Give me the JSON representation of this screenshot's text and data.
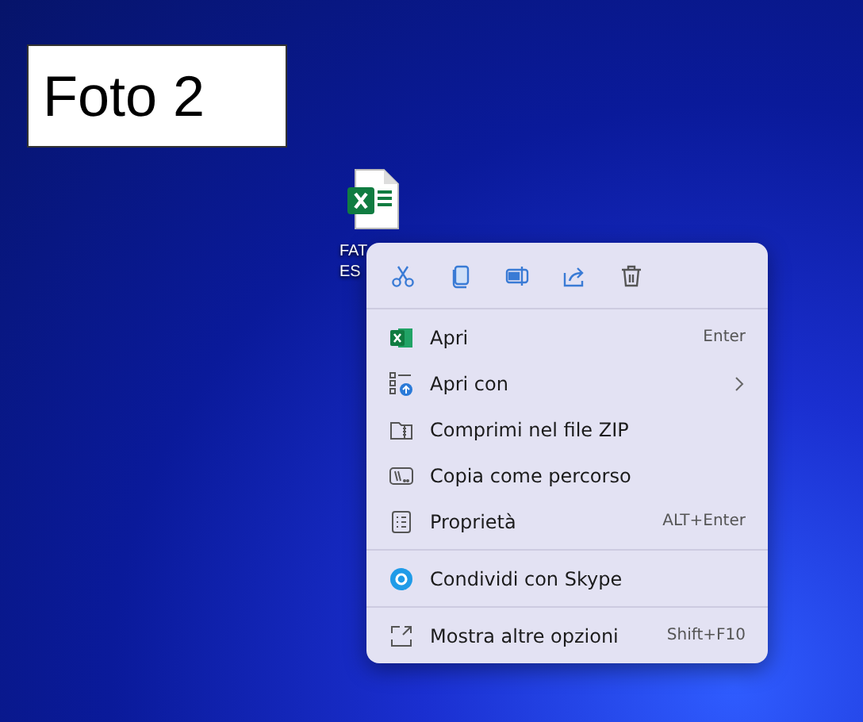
{
  "annotation": {
    "label": "Foto 2"
  },
  "desktop_icon": {
    "label_lines": [
      "FAT",
      "ES"
    ]
  },
  "context_menu": {
    "sections": [
      {
        "items": [
          {
            "label": "Apri",
            "shortcut": "Enter",
            "submenu": false
          },
          {
            "label": "Apri con",
            "submenu": true
          },
          {
            "label": "Comprimi nel file ZIP",
            "submenu": false
          },
          {
            "label": "Copia come percorso",
            "submenu": false
          },
          {
            "label": "Proprietà",
            "shortcut": "ALT+Enter",
            "submenu": false
          }
        ]
      },
      {
        "items": [
          {
            "label": "Condividi con Skype",
            "submenu": false
          }
        ]
      },
      {
        "items": [
          {
            "label": "Mostra altre opzioni",
            "shortcut": "Shift+F10",
            "submenu": false
          }
        ]
      }
    ]
  }
}
